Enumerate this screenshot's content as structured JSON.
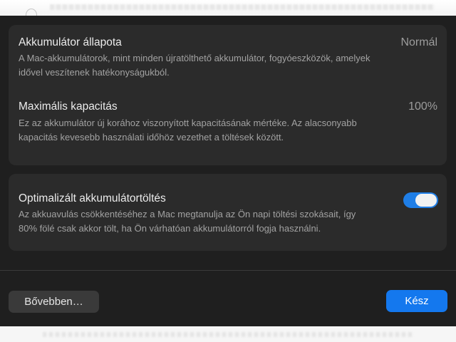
{
  "battery_health": {
    "title": "Akkumulátor állapota",
    "value": "Normál",
    "description": "A Mac-akkumulátorok, mint minden újratölthető akkumulátor, fogyóeszközök, amelyek idővel veszítenek hatékonyságukból."
  },
  "max_capacity": {
    "title": "Maximális kapacitás",
    "value": "100%",
    "description": "Ez az akkumulátor új korához viszonyított kapacitásának mértéke. Az alacsonyabb kapacitás kevesebb használati időhöz vezethet a töltések között."
  },
  "optimized_charging": {
    "title": "Optimalizált akkumulátortöltés",
    "enabled": true,
    "description": "Az akkuavulás csökkentéséhez a Mac megtanulja az Ön napi töltési szokásait, így 80% fölé csak akkor tölt, ha Ön várhatóan akkumulátorról fogja használni."
  },
  "footer": {
    "more_label": "Bővebben…",
    "done_label": "Kész"
  },
  "colors": {
    "accent": "#1478ee",
    "dialog_bg": "#1f1f1f",
    "group_bg": "#2b2b2b"
  },
  "icons": [
    "apple-logo-icon"
  ]
}
